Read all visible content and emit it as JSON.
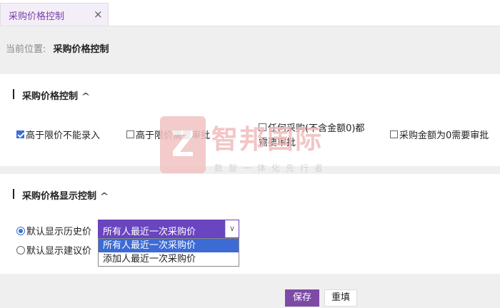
{
  "tab": {
    "label": "采购价格控制",
    "close": "×"
  },
  "breadcrumb": {
    "label": "当前位置:",
    "current": "采购价格控制"
  },
  "section1": {
    "title": "采购价格控制",
    "options": [
      {
        "label": "高于限价不能录入",
        "checked": true
      },
      {
        "label": "高于限价需要审批",
        "checked": false
      },
      {
        "label_line1": "任何采购(不含金额0)都",
        "label_line2": "需要审批",
        "checked": false
      },
      {
        "label": "采购金额为0需要审批",
        "checked": false
      }
    ]
  },
  "section2": {
    "title": "采购价格显示控制",
    "radios": [
      {
        "label": "默认显示历史价",
        "selected": true
      },
      {
        "label": "默认显示建议价",
        "selected": false
      }
    ],
    "select": {
      "value": "所有人最近一次采购价",
      "options": [
        "所有人最近一次采购价",
        "添加人最近一次采购价"
      ]
    }
  },
  "buttons": {
    "save": "保存",
    "reset": "重填"
  },
  "watermark": {
    "name": "智邦国际",
    "tagline": "数智一体化先行者"
  },
  "colors": {
    "accent": "#7d4aa6",
    "select_bg": "#6a45c0",
    "checkbox": "#3b6fd4"
  }
}
